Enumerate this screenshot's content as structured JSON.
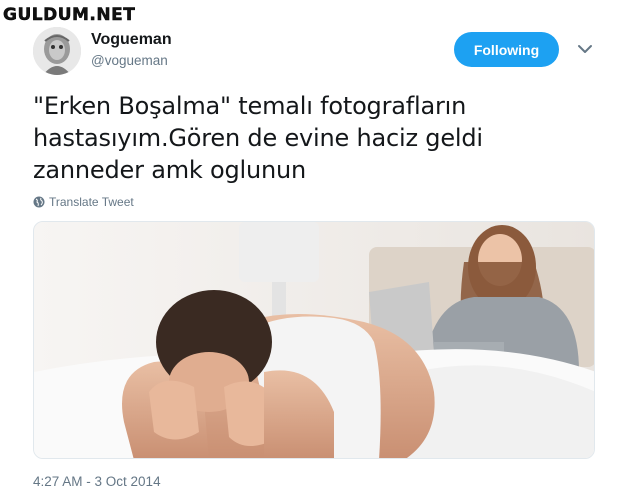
{
  "watermark": "GULDUM.NET",
  "author": {
    "display_name": "Vogueman",
    "handle": "@vogueman"
  },
  "follow_button": {
    "label": "Following",
    "color": "#1da1f2"
  },
  "caret_icon": "chevron-down-icon",
  "tweet": {
    "text_lines": [
      "\"Erken Boşalma\" temalı fotografların",
      "hastasıyım.Gören de evine haciz geldi",
      "zanneder amk oglunun"
    ]
  },
  "translate": {
    "icon": "globe-icon",
    "label": "Translate Tweet"
  },
  "media": {
    "description_icon": "photo"
  },
  "timestamp": "4:27 AM - 3 Oct 2014",
  "colors": {
    "accent": "#1da1f2",
    "secondary_text": "#657786",
    "primary_text": "#14171a"
  }
}
